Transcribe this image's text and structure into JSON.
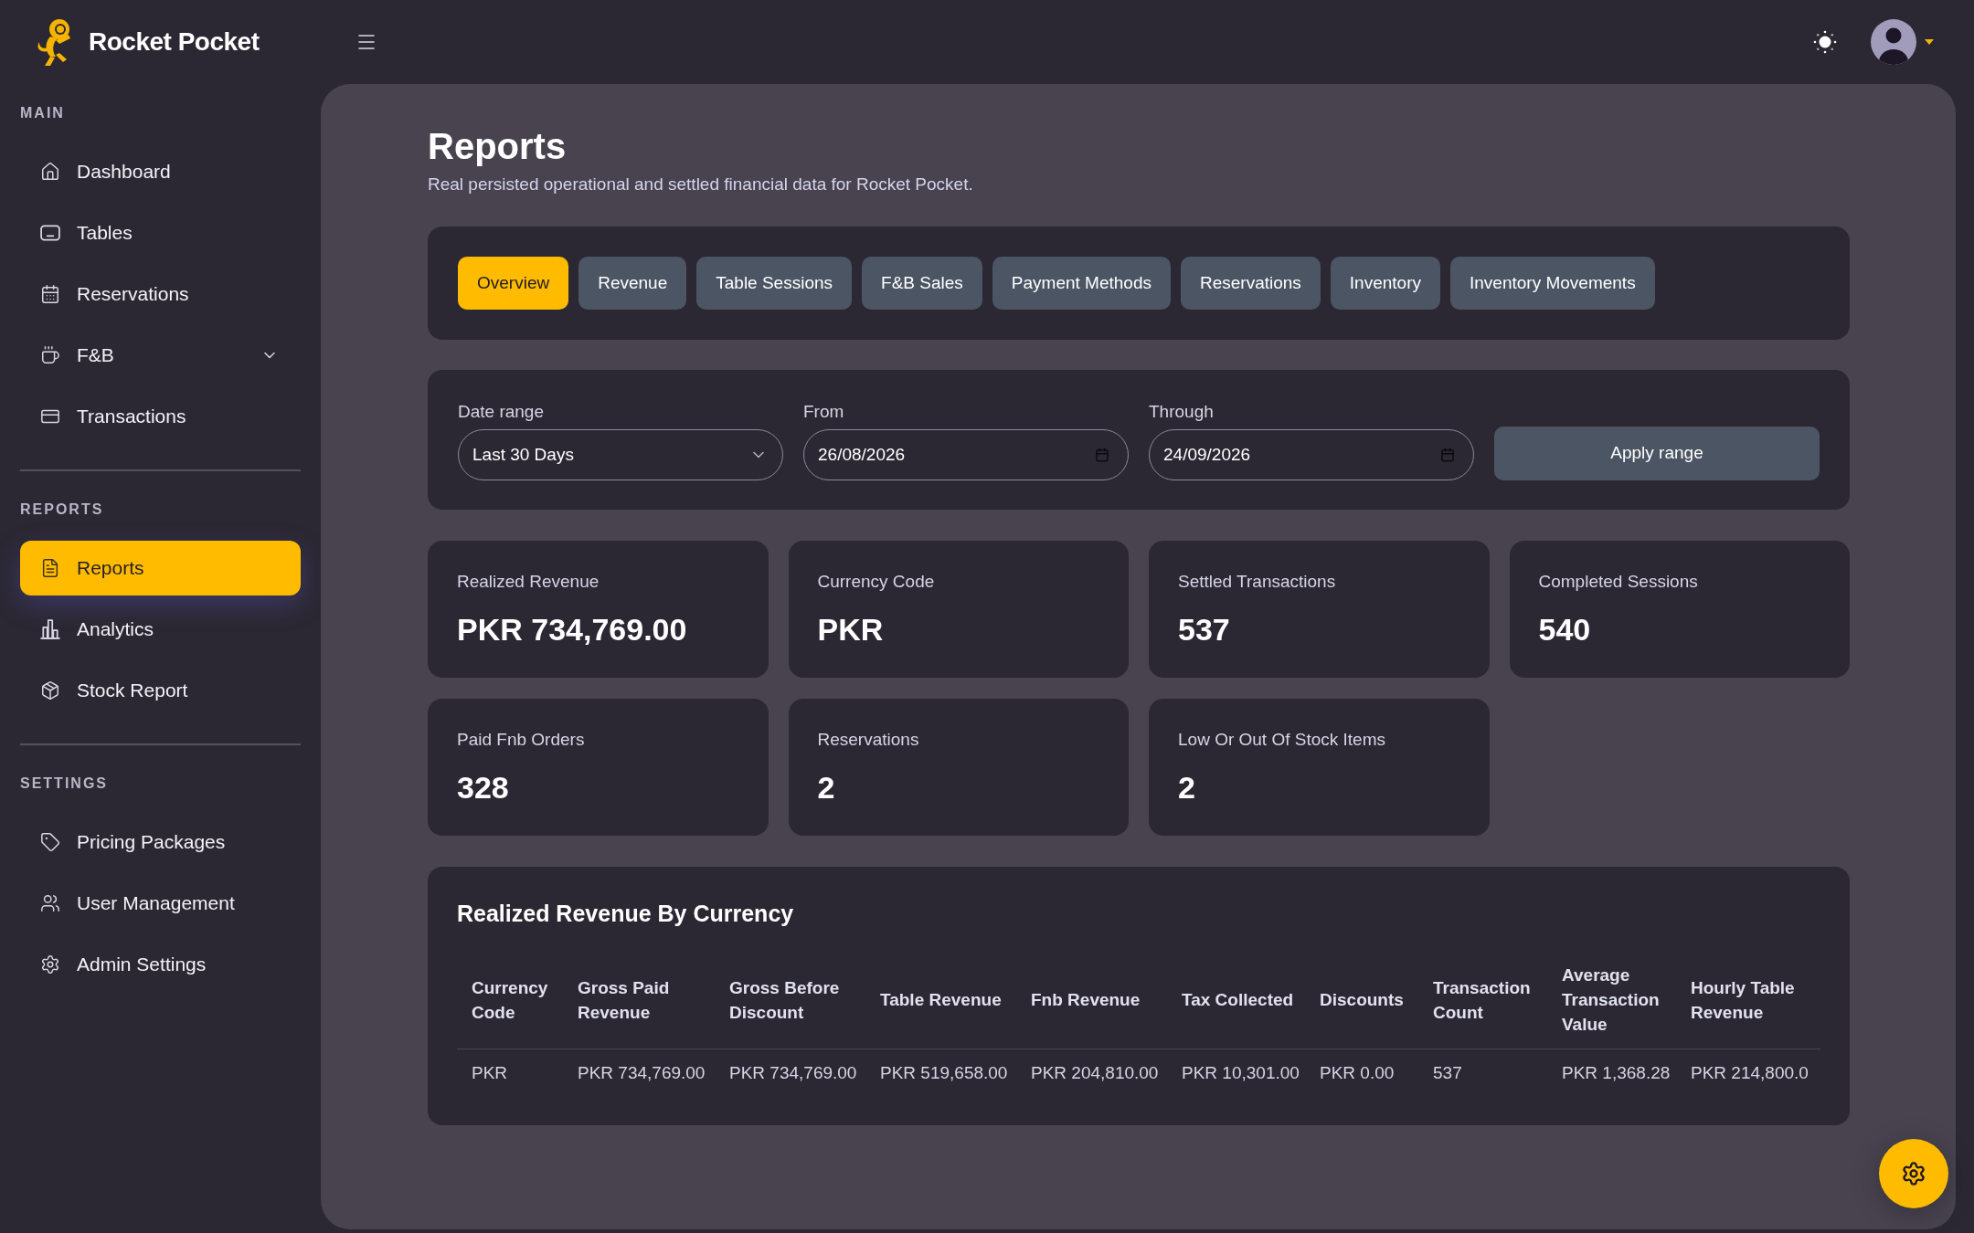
{
  "brand": {
    "name": "Rocket Pocket"
  },
  "sidebar": {
    "sections": [
      {
        "title": "MAIN",
        "items": [
          {
            "label": "Dashboard",
            "selected": false
          },
          {
            "label": "Tables",
            "selected": false
          },
          {
            "label": "Reservations",
            "selected": false
          },
          {
            "label": "F&B",
            "selected": false,
            "expanded": false
          },
          {
            "label": "Transactions",
            "selected": false
          }
        ]
      },
      {
        "title": "REPORTS",
        "items": [
          {
            "label": "Reports",
            "selected": true
          },
          {
            "label": "Analytics",
            "selected": false
          },
          {
            "label": "Stock Report",
            "selected": false
          }
        ]
      },
      {
        "title": "SETTINGS",
        "items": [
          {
            "label": "Pricing Packages",
            "selected": false
          },
          {
            "label": "User Management",
            "selected": false
          },
          {
            "label": "Admin Settings",
            "selected": false
          }
        ]
      }
    ]
  },
  "page": {
    "title": "Reports",
    "subtitle": "Real persisted operational and settled financial data for Rocket Pocket."
  },
  "tabs": [
    {
      "label": "Overview",
      "selected": true
    },
    {
      "label": "Revenue",
      "selected": false
    },
    {
      "label": "Table Sessions",
      "selected": false
    },
    {
      "label": "F&B Sales",
      "selected": false
    },
    {
      "label": "Payment Methods",
      "selected": false
    },
    {
      "label": "Reservations",
      "selected": false
    },
    {
      "label": "Inventory",
      "selected": false
    },
    {
      "label": "Inventory Movements",
      "selected": false
    }
  ],
  "filters": {
    "date_range": {
      "label": "Date range",
      "value": "Last 30 Days"
    },
    "from": {
      "label": "From",
      "value": "26/08/2026"
    },
    "through": {
      "label": "Through",
      "value": "24/09/2026"
    },
    "apply_button": "Apply range"
  },
  "stats": [
    {
      "label": "Realized Revenue",
      "value": "PKR 734,769.00"
    },
    {
      "label": "Currency Code",
      "value": "PKR"
    },
    {
      "label": "Settled Transactions",
      "value": "537"
    },
    {
      "label": "Completed Sessions",
      "value": "540"
    },
    {
      "label": "Paid Fnb Orders",
      "value": "328"
    },
    {
      "label": "Reservations",
      "value": "2"
    },
    {
      "label": "Low Or Out Of Stock Items",
      "value": "2"
    }
  ],
  "revenue_table": {
    "title": "Realized Revenue By Currency",
    "columns": [
      "Currency Code",
      "Gross Paid Revenue",
      "Gross Before Discount",
      "Table Revenue",
      "Fnb Revenue",
      "Tax Collected",
      "Discounts",
      "Transaction Count",
      "Average Transaction Value",
      "Hourly Table Revenue"
    ],
    "rows": [
      [
        "PKR",
        "PKR 734,769.00",
        "PKR 734,769.00",
        "PKR 519,658.00",
        "PKR 204,810.00",
        "PKR 10,301.00",
        "PKR 0.00",
        "537",
        "PKR 1,368.28",
        "PKR 214,800.0"
      ]
    ]
  }
}
